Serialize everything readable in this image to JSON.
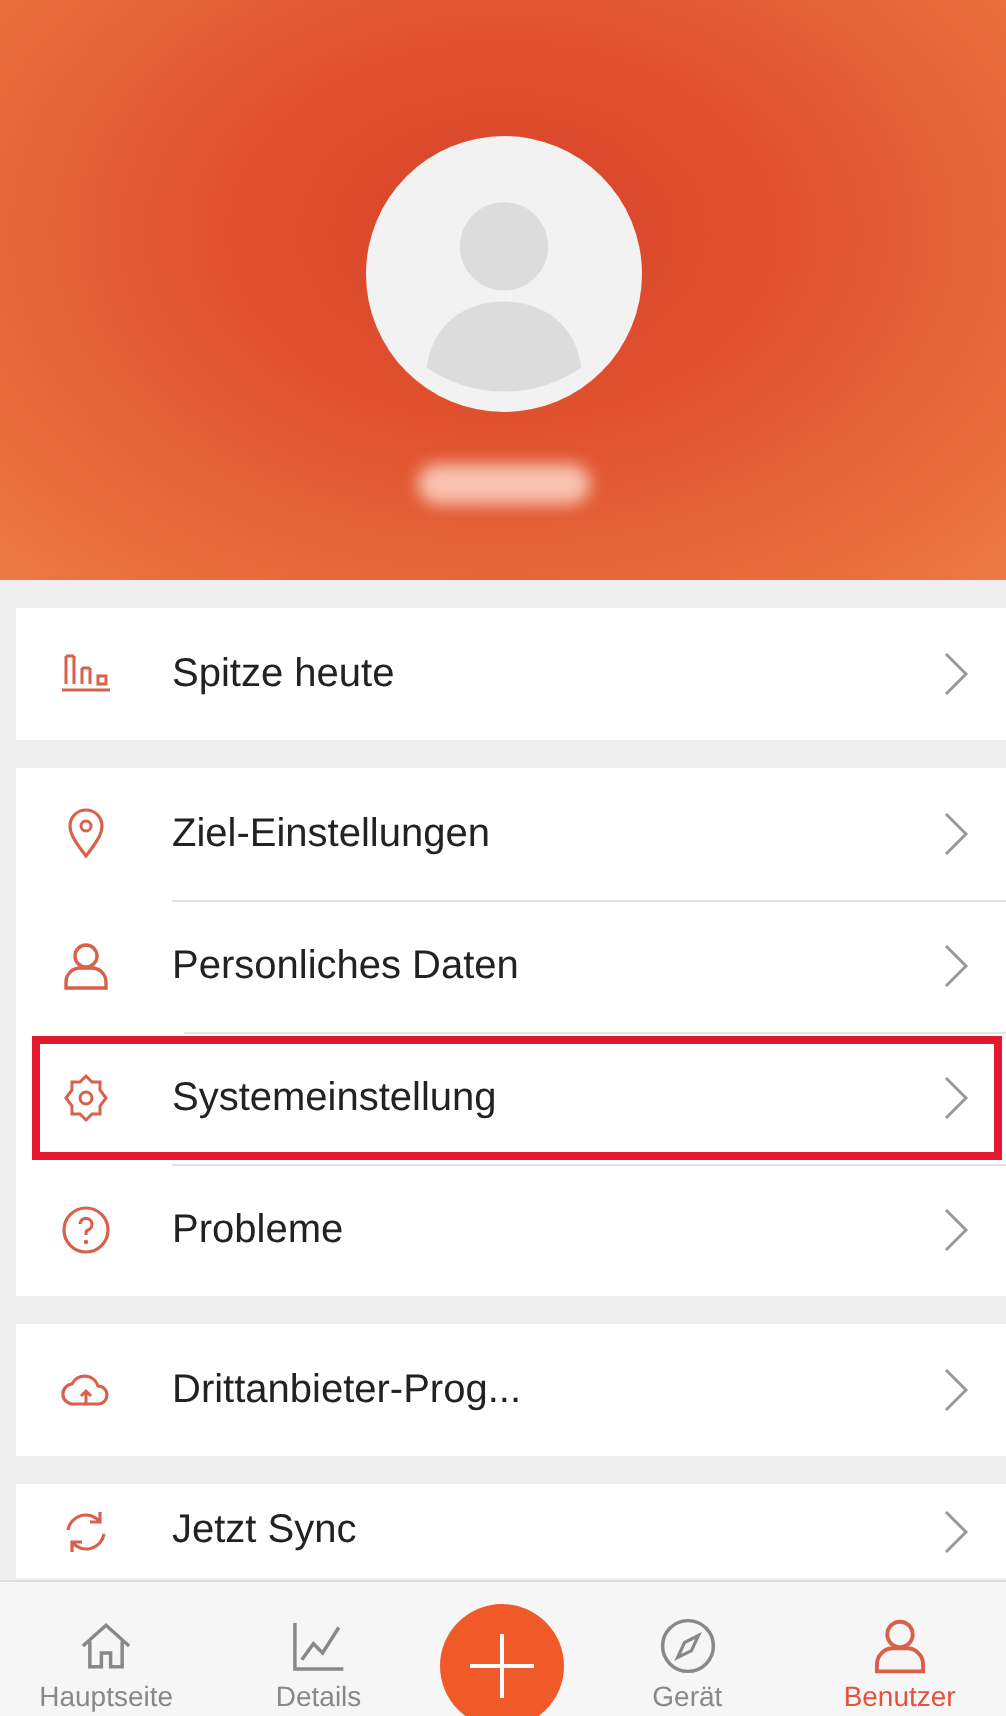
{
  "menu_sections": [
    {
      "items": [
        {
          "label": "Spitze heute",
          "highlighted": false
        }
      ]
    },
    {
      "items": [
        {
          "label": "Ziel-Einstellungen",
          "highlighted": false
        },
        {
          "label": "Personliches Daten",
          "highlighted": false
        },
        {
          "label": "Systemeinstellung",
          "highlighted": true
        },
        {
          "label": "Probleme",
          "highlighted": false
        }
      ]
    },
    {
      "items": [
        {
          "label": "Drittanbieter-Prog...",
          "highlighted": false
        }
      ]
    },
    {
      "items": [
        {
          "label": "Jetzt Sync",
          "highlighted": false
        }
      ]
    }
  ],
  "tab_bar": [
    {
      "kind": "tab",
      "label": "Hauptseite",
      "selected": false
    },
    {
      "kind": "tab",
      "label": "Details",
      "selected": false
    },
    {
      "kind": "add"
    },
    {
      "kind": "tab",
      "label": "Gerät",
      "selected": false
    },
    {
      "kind": "tab",
      "label": "Benutzer",
      "selected": true
    }
  ]
}
